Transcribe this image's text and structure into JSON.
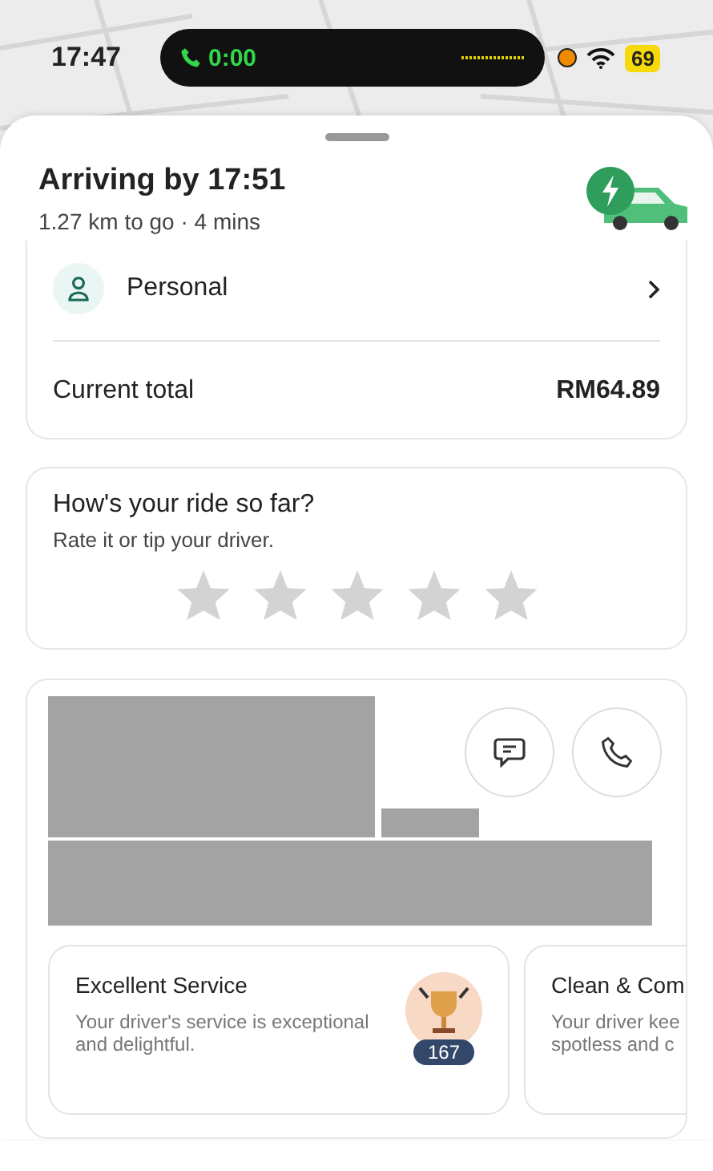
{
  "status_bar": {
    "time": "17:47",
    "call_timer": "0:00",
    "battery": "69"
  },
  "trip": {
    "title": "Arriving by 17:51",
    "subtitle": "1.27 km to go · 4 mins"
  },
  "payment": {
    "profile": "Personal",
    "total_label": "Current total",
    "total_value": "RM64.89"
  },
  "rating": {
    "title": "How's your ride so far?",
    "subtitle": "Rate it or tip your driver.",
    "stars": 0
  },
  "driver": {
    "compliments": [
      {
        "kind": "award",
        "title": "Excellent Service",
        "description": "Your driver's service is exceptional and delightful.",
        "count": "167"
      },
      {
        "kind": "partial",
        "title": "Clean & Com",
        "description_lines": [
          "Your driver kee",
          "spotless and c"
        ]
      }
    ]
  }
}
